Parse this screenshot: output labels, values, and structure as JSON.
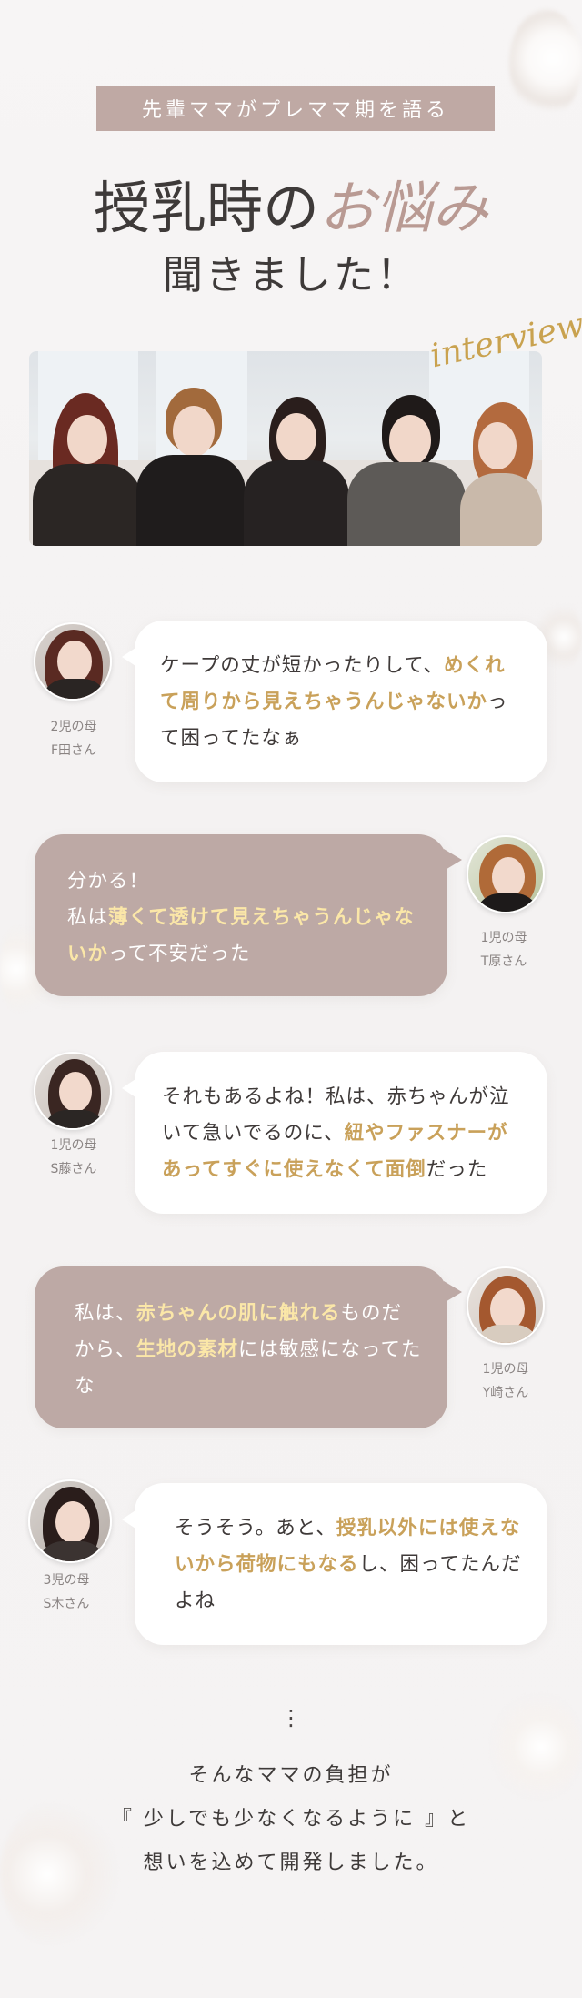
{
  "header": {
    "ribbon": "先輩ママがプレママ期を語る",
    "title_main": "授乳時の",
    "title_accent": "お悩み",
    "subtitle": "聞きました！",
    "script_word": "interview"
  },
  "conversation": [
    {
      "side": "left",
      "who_line1": "2児の母",
      "who_line2": "F田さん",
      "parts": [
        {
          "text": "ケープの丈が短かったりして、",
          "hl": false
        },
        {
          "text": "めくれて周りから見えちゃうんじゃないか",
          "hl": true
        },
        {
          "text": "って困ってたなぁ",
          "hl": false
        }
      ]
    },
    {
      "side": "right",
      "who_line1": "1児の母",
      "who_line2": "T原さん",
      "parts": [
        {
          "text": "分かる！",
          "hl": false
        },
        {
          "text": "私は",
          "hl": false
        },
        {
          "text": "薄くて透けて見えちゃうんじゃないか",
          "hl": true
        },
        {
          "text": "って不安だった",
          "hl": false
        }
      ]
    },
    {
      "side": "left",
      "who_line1": "1児の母",
      "who_line2": "S藤さん",
      "parts": [
        {
          "text": "それもあるよね！私は、赤ちゃんが泣いて急いでるのに、",
          "hl": false
        },
        {
          "text": "紐やファスナーがあってすぐに使えなくて面倒",
          "hl": true
        },
        {
          "text": "だった",
          "hl": false
        }
      ]
    },
    {
      "side": "right",
      "who_line1": "1児の母",
      "who_line2": "Y崎さん",
      "parts": [
        {
          "text": "私は、",
          "hl": false
        },
        {
          "text": "赤ちゃんの肌に触れる",
          "hl": true
        },
        {
          "text": "ものだから、",
          "hl": false
        },
        {
          "text": "生地の素材",
          "hl": true
        },
        {
          "text": "には敏感になってたな",
          "hl": false
        }
      ]
    },
    {
      "side": "left",
      "who_line1": "3児の母",
      "who_line2": "S木さん",
      "parts": [
        {
          "text": "そうそう。あと、",
          "hl": false
        },
        {
          "text": "授乳以外には使えないから荷物にもなる",
          "hl": true
        },
        {
          "text": "し、困ってたんだよね",
          "hl": false
        }
      ]
    }
  ],
  "footer": {
    "dots": "⋮",
    "line1": "そんなママの負担が",
    "line2": "『 少しでも少なくなるように 』と",
    "line3": "想いを込めて開発しました。"
  },
  "colors": {
    "ribbon": "#bfa9a4",
    "accent": "#b99a93",
    "highlight_gold": "#c9a15a",
    "highlight_cream": "#fbe7a8",
    "rose_bubble": "#bda9a5"
  }
}
